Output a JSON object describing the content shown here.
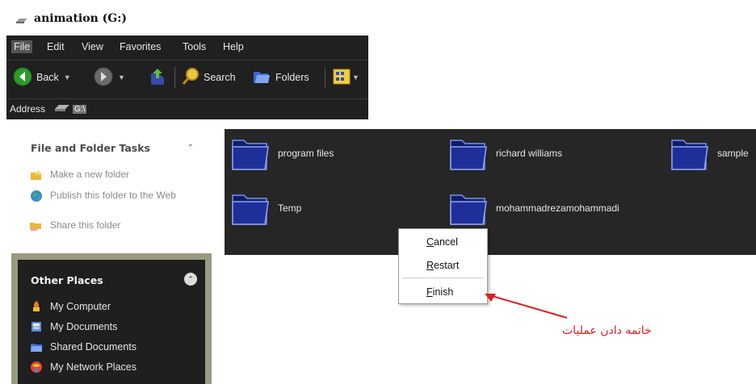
{
  "window": {
    "title": "animation (G:)"
  },
  "menubar": {
    "items": [
      "File",
      "Edit",
      "View",
      "Favorites",
      "Tools",
      "Help"
    ]
  },
  "toolbar": {
    "back_label": "Back",
    "search_label": "Search",
    "folders_label": "Folders"
  },
  "address": {
    "label": "Address",
    "value": "G:\\"
  },
  "tasks_panel": {
    "title": "File and Folder Tasks",
    "items": [
      "Make a new folder",
      "Publish this folder to the Web",
      "Share this folder"
    ]
  },
  "other_places": {
    "title": "Other Places",
    "items": [
      "My Computer",
      "My Documents",
      "Shared Documents",
      "My Network Places"
    ]
  },
  "folders": [
    "program files",
    "richard williams",
    "sample",
    "Temp",
    "mohammadrezamohammadi"
  ],
  "context_menu": {
    "items": [
      {
        "mnemonic": "C",
        "rest": "ancel"
      },
      {
        "mnemonic": "R",
        "rest": "estart"
      },
      {
        "mnemonic": "F",
        "rest": "inish"
      }
    ]
  },
  "annotation": {
    "text": "خاتمه دادن عملیات",
    "color": "#d92020"
  },
  "colors": {
    "chrome": "#202020",
    "file_area": "#262626",
    "folder_blue": "#1f2f9a",
    "other_places_frame": "#9a9a83"
  }
}
